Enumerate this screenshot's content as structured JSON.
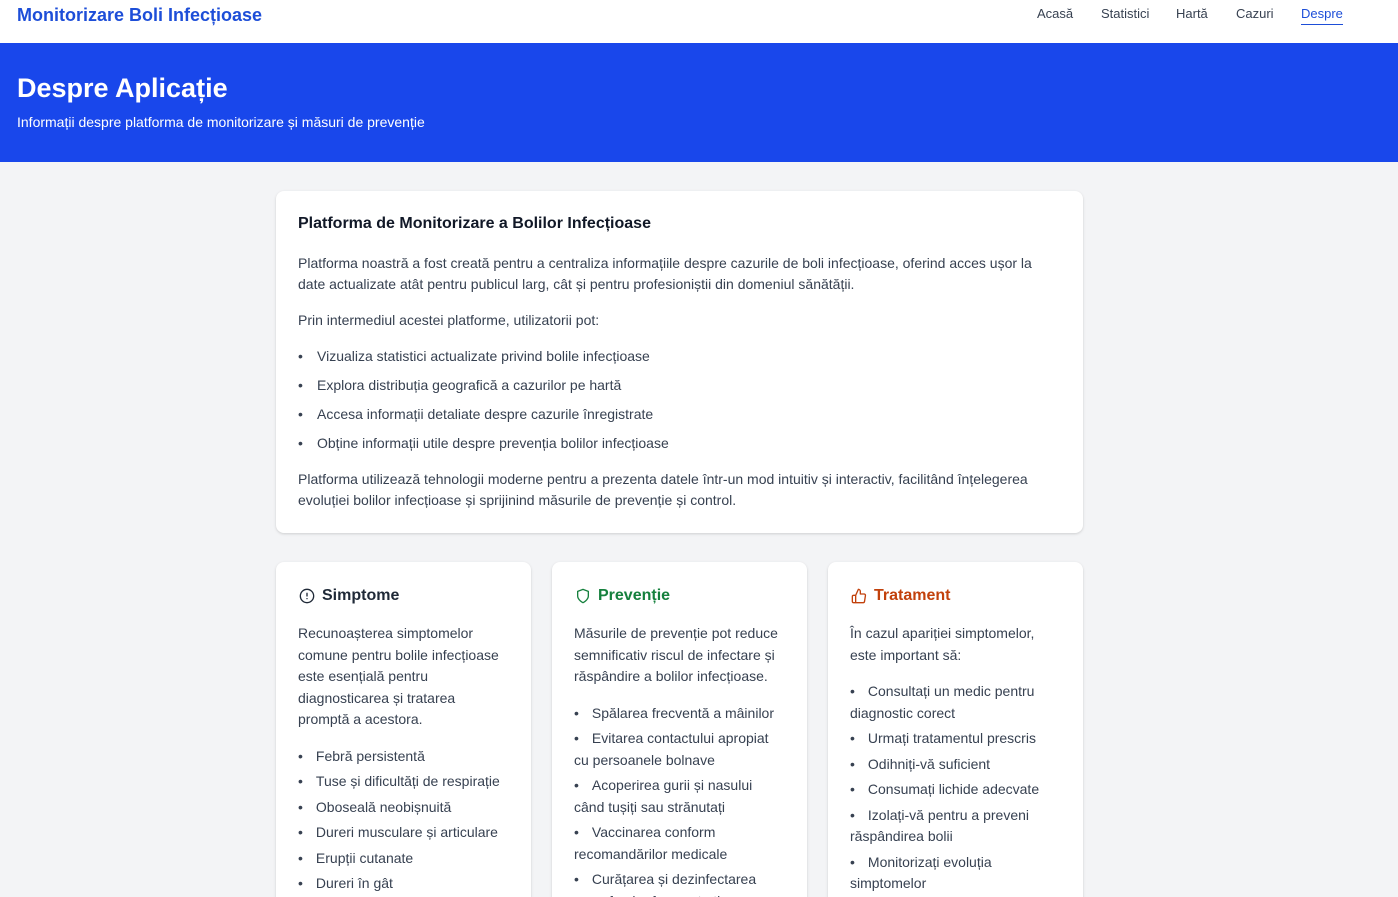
{
  "nav": {
    "brand": "Monitorizare Boli Infecțioase",
    "links": [
      "Acasă",
      "Statistici",
      "Hartă",
      "Cazuri",
      "Despre"
    ]
  },
  "hero": {
    "title": "Despre Aplicație",
    "subtitle": "Informații despre platforma de monitorizare și măsuri de prevenție"
  },
  "about": {
    "title": "Platforma de Monitorizare a Bolilor Infecțioase",
    "intro": "Platforma noastră a fost creată pentru a centraliza informațiile despre cazurile de boli infecțioase, oferind acces ușor la date actualizate atât pentru publicul larg, cât și pentru profesioniștii din domeniul sănătății.",
    "lead": "Prin intermediul acestei platforme, utilizatorii pot:",
    "items": [
      "Vizualiza statistici actualizate privind bolile infecțioase",
      "Explora distribuția geografică a cazurilor pe hartă",
      "Accesa informații detaliate despre cazurile înregistrate",
      "Obține informații utile despre prevenția bolilor infecțioase"
    ],
    "outro": "Platforma utilizează tehnologii moderne pentru a prezenta datele într-un mod intuitiv și interactiv, facilitând înțelegerea evoluției bolilor infecțioase și sprijinind măsurile de prevenție și control."
  },
  "symptoms": {
    "title": "Simptome",
    "icon": "alert-circle-icon",
    "color": "#1f2937",
    "text": "Recunoașterea simptomelor comune pentru bolile infecțioase este esențială pentru diagnosticarea și tratarea promptă a acestora.",
    "items": [
      "Febră persistentă",
      "Tuse și dificultăți de respirație",
      "Oboseală neobișnuită",
      "Dureri musculare și articulare",
      "Erupții cutanate",
      "Dureri în gât"
    ]
  },
  "prevention": {
    "title": "Prevenție",
    "icon": "shield-icon",
    "color": "#15803d",
    "text": "Măsurile de prevenție pot reduce semnificativ riscul de infectare și răspândire a bolilor infecțioase.",
    "items": [
      "Spălarea frecventă a mâinilor",
      "Evitarea contactului apropiat cu persoanele bolnave",
      "Acoperirea gurii și nasului când tușiți sau strănutați",
      "Vaccinarea conform recomandărilor medicale",
      "Curățarea și dezinfectarea suprafețelor frecvent atinse"
    ]
  },
  "treatment": {
    "title": "Tratament",
    "icon": "thumbs-up-icon",
    "color": "#c2410c",
    "text": "În cazul apariției simptomelor, este important să:",
    "items": [
      "Consultați un medic pentru diagnostic corect",
      "Urmați tratamentul prescris",
      "Odihniți-vă suficient",
      "Consumați lichide adecvate",
      "Izolați-vă pentru a preveni răspândirea bolii",
      "Monitorizați evoluția simptomelor"
    ]
  }
}
